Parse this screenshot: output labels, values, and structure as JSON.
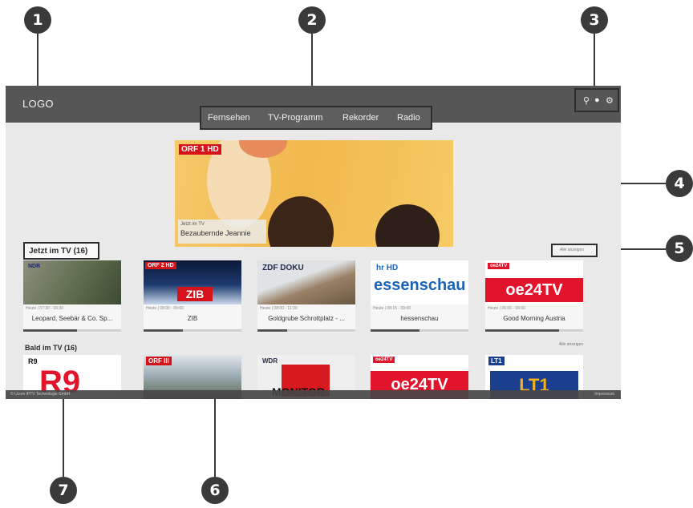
{
  "callouts": [
    "1",
    "2",
    "3",
    "4",
    "5",
    "6",
    "7"
  ],
  "header": {
    "logo": "LOGO",
    "nav": [
      "Fernsehen",
      "TV-Programm",
      "Rekorder",
      "Radio"
    ],
    "icons": [
      "search-icon",
      "user-icon",
      "gear-icon"
    ]
  },
  "hero": {
    "station": "ORF 1 HD",
    "subtitle": "Jetzt im TV",
    "title": "Bezaubernde Jeannie"
  },
  "now": {
    "title": "Jetzt im TV (16)",
    "show_all": "Alle anzeigen",
    "cards": [
      {
        "logo": "NDR",
        "meta": "Heute | 07:30 - 09:30",
        "title": "Leopard, Seebär & Co. Sp...",
        "progress": 0.55
      },
      {
        "logo": "ORF 2 HD",
        "meta": "Heute | 08:00 - 09:00",
        "title": "ZIB",
        "progress": 0.4
      },
      {
        "logo": "ZDF DOKU",
        "meta": "Heute | 08:00 - 11:30",
        "title": "Goldgrube Schrottplatz - ...",
        "progress": 0.3
      },
      {
        "logo": "hr HD",
        "meta": "Heute | 08:15 - 09:00",
        "title": "hessenschau",
        "progress": 0.5
      },
      {
        "logo": "oe24TV",
        "meta": "Heute | 06:00 - 09:00",
        "title": "Good Morning Austria",
        "progress": 0.75
      }
    ]
  },
  "soon": {
    "title": "Bald im TV (16)",
    "show_all": "Alle anzeigen",
    "cards": [
      {
        "logo": "R9",
        "text": "R9"
      },
      {
        "logo": "ORF III",
        "text": ""
      },
      {
        "logo": "WDR",
        "text": "MONITOR"
      },
      {
        "logo": "oe24TV",
        "text": "oe24TV"
      },
      {
        "logo": "LT1",
        "text": "LT1"
      }
    ]
  },
  "zib_text": "ZIB",
  "hessen_text": "essenschau",
  "oe24_text": "oe24TV",
  "footer": {
    "left": "© Ucom IPTV Technologie GmbH",
    "right": "Impressum"
  }
}
